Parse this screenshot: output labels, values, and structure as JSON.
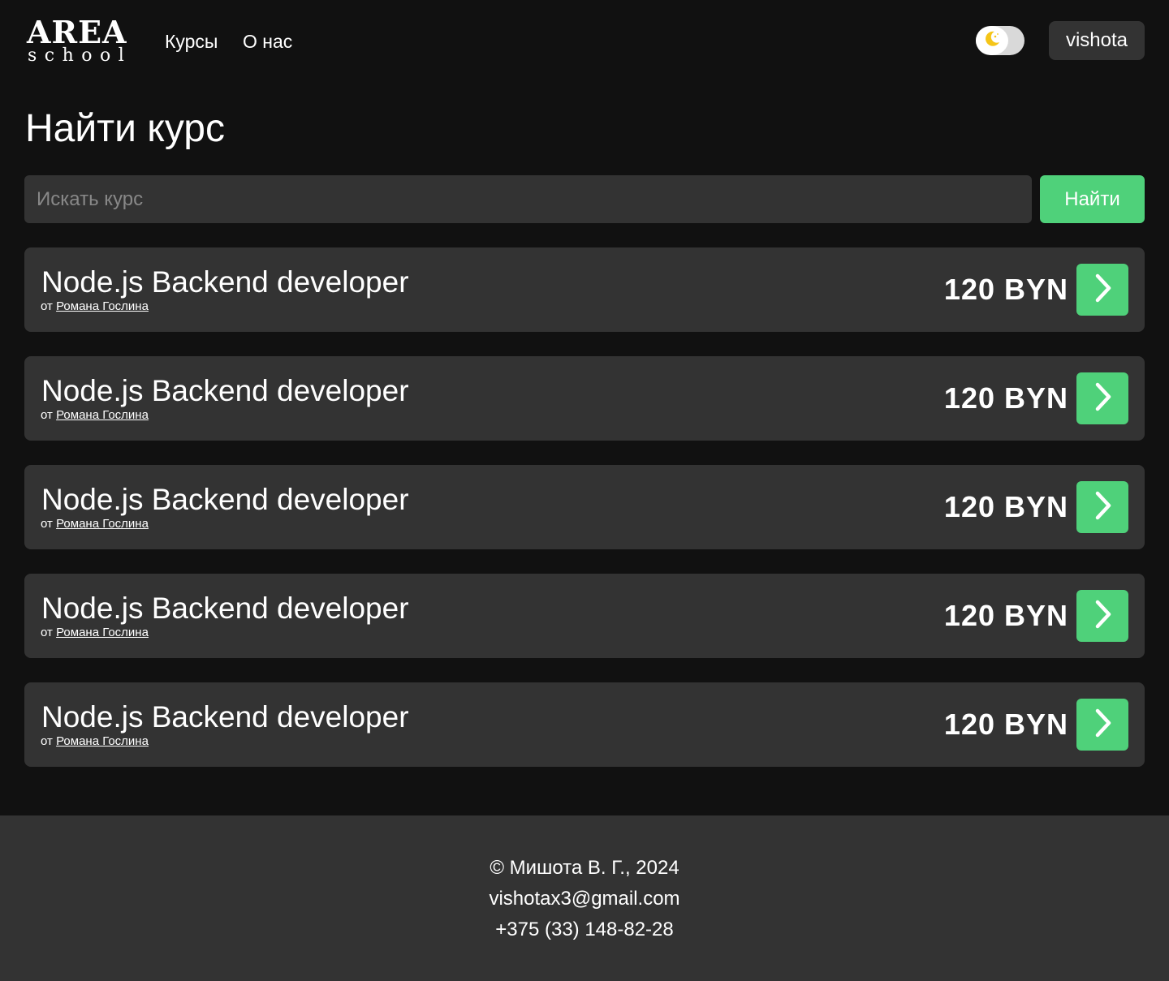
{
  "header": {
    "logo_main": "AREA",
    "logo_sub": "school",
    "nav": [
      {
        "label": "Курсы"
      },
      {
        "label": "О нас"
      }
    ],
    "theme_toggle_icon": "moon-icon",
    "user_label": "vishota"
  },
  "main": {
    "title": "Найти курс",
    "search": {
      "placeholder": "Искать курс",
      "value": "",
      "button_label": "Найти"
    },
    "courses": [
      {
        "title": "Node.js Backend developer",
        "author_prefix": "от",
        "author": "Романа Гослина",
        "price": "120 BYN"
      },
      {
        "title": "Node.js Backend developer",
        "author_prefix": "от",
        "author": "Романа Гослина",
        "price": "120 BYN"
      },
      {
        "title": "Node.js Backend developer",
        "author_prefix": "от",
        "author": "Романа Гослина",
        "price": "120 BYN"
      },
      {
        "title": "Node.js Backend developer",
        "author_prefix": "от",
        "author": "Романа Гослина",
        "price": "120 BYN"
      },
      {
        "title": "Node.js Backend developer",
        "author_prefix": "от",
        "author": "Романа Гослина",
        "price": "120 BYN"
      }
    ],
    "course_go_icon": "chevron-right-icon"
  },
  "footer": {
    "copyright": "© Мишота В. Г., 2024",
    "email": "vishotax3@gmail.com",
    "phone": "+375 (33) 148-82-28"
  },
  "colors": {
    "background": "#111111",
    "surface": "#333333",
    "accent": "#4fd17a",
    "text": "#ffffff",
    "toggle_track": "#d9d9d9",
    "moon": "#f5c518"
  }
}
